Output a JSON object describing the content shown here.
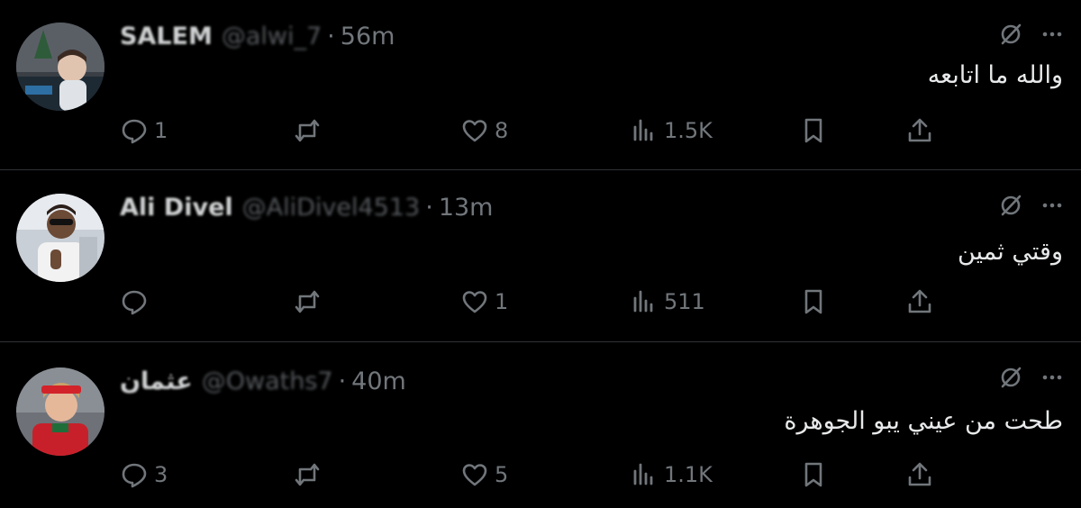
{
  "tweets": [
    {
      "display_name": "SALEM",
      "handle": "@alwi_7",
      "separator": "·",
      "time": "56m",
      "text": "والله ما اتابعه",
      "replies": "1",
      "likes": "8",
      "views": "1.5K"
    },
    {
      "display_name": "Ali Divel",
      "handle": "@AliDivel4513",
      "separator": "·",
      "time": "13m",
      "text": "وقتي ثمين",
      "replies": "",
      "likes": "1",
      "views": "511"
    },
    {
      "display_name": "عثمان",
      "handle": "@Owaths7",
      "separator": "·",
      "time": "40m",
      "text": "طحت من عيني يبو الجوهرة",
      "replies": "3",
      "likes": "5",
      "views": "1.1K"
    }
  ],
  "icons": {
    "reply": "reply-icon",
    "retweet": "retweet-icon",
    "like": "heart-icon",
    "views": "views-icon",
    "bookmark": "bookmark-icon",
    "share": "share-icon",
    "grok": "grok-icon",
    "more": "more-icon"
  },
  "colors": {
    "background": "#000000",
    "text": "#e7e9ea",
    "muted": "#71767b",
    "divider": "#2f3336"
  }
}
